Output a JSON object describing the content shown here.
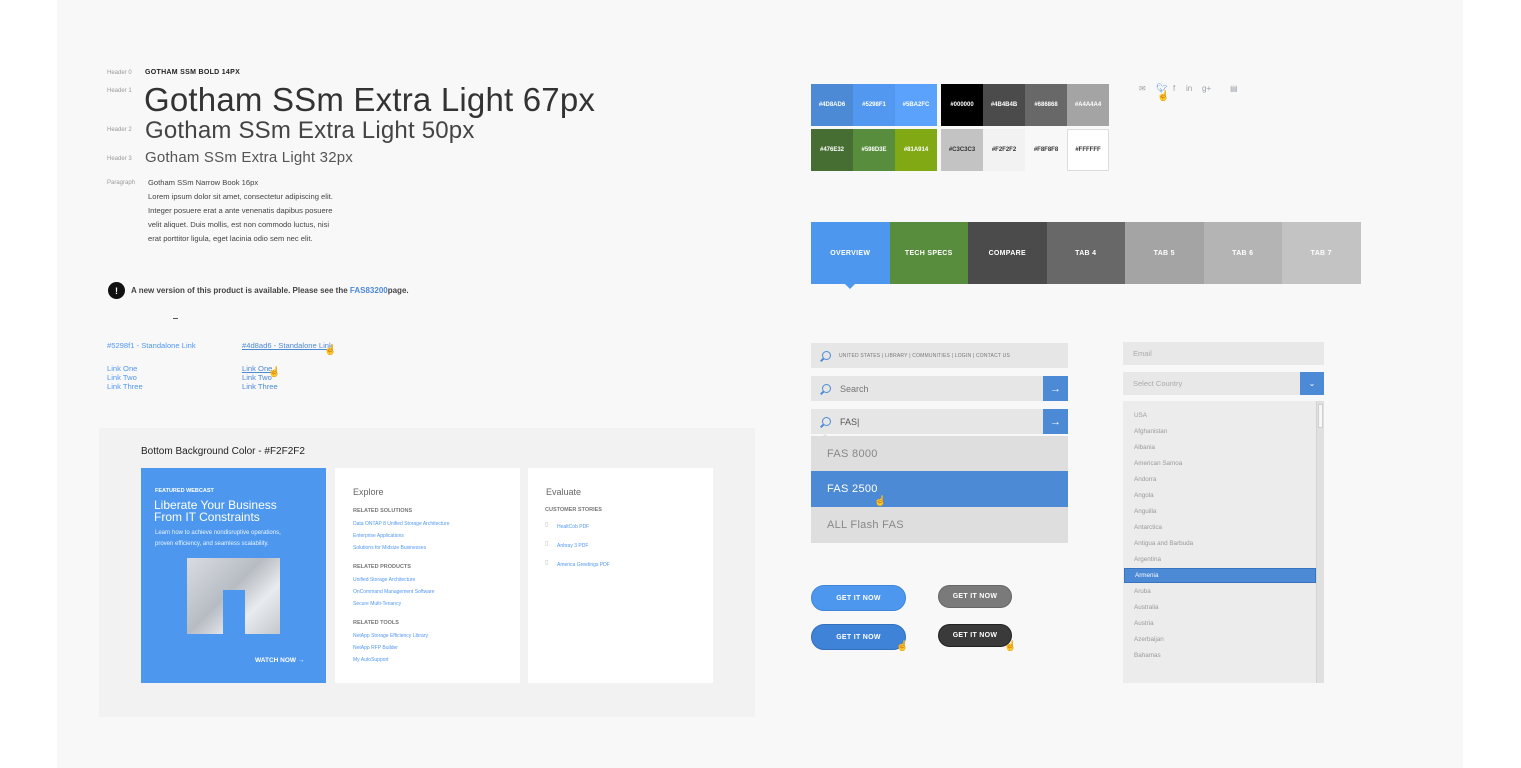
{
  "typography": {
    "header0_label": "Header 0",
    "header0_text": "GOTHAM SSM BOLD 14PX",
    "header1_label": "Header 1",
    "header1_text": "Gotham SSm Extra Light 67px",
    "header2_label": "Header 2",
    "header2_text": "Gotham SSm Extra Light 50px",
    "header3_label": "Header 3",
    "header3_text": "Gotham SSm Extra Light 32px",
    "paragraph_label": "Paragraph",
    "paragraph_lines": [
      "Gotham SSm Narrow Book 16px",
      "Lorem ipsum dolor sit amet, consectetur adipiscing elit.",
      "Integer posuere erat a ante venenatis dapibus posuere",
      "velit aliquet. Duis mollis, est non commodo luctus, nisi",
      "erat porttitor ligula, eget lacinia odio sem nec elit."
    ]
  },
  "alert": {
    "icon": "!",
    "text_before": "A new version of this product is available. Please see the ",
    "link": "FAS83200",
    "text_after": " page."
  },
  "links": {
    "col1_standalone": "#5298f1 - Standalone Link",
    "col2_standalone": "#4d8ad6 - Standalone Link",
    "col1_list": [
      "Link One",
      "Link Two",
      "Link Three"
    ],
    "col2_list": [
      "Link One",
      "Link Two",
      "Link Three"
    ]
  },
  "bottom_panel": {
    "title": "Bottom Background Color - #F2F2F2",
    "webcast": {
      "tag": "FEATURED WEBCAST",
      "title_line1": "Liberate Your Business",
      "title_line2": "From IT Constraints",
      "desc_line1": "Learn how to achieve nondisruptive operations,",
      "desc_line2": "proven efficiency, and seamless scalability.",
      "cta": "WATCH NOW →"
    },
    "explore": {
      "title": "Explore",
      "sections": [
        {
          "heading": "RELATED SOLUTIONS",
          "links": [
            "Data ONTAP 8 Unified Storage Architecture",
            "Enterprise Applications",
            "Solutions for Midsize Businesses"
          ]
        },
        {
          "heading": "RELATED PRODUCTS",
          "links": [
            "Unified Storage Architecture",
            "OnCommand Management Software",
            "Secure Multi-Tenancy"
          ]
        },
        {
          "heading": "RELATED TOOLS",
          "links": [
            "NetApp Storage Efficiency Library",
            "NetApp RFP Builder",
            "My AutoSupport"
          ]
        }
      ]
    },
    "evaluate": {
      "title": "Evaluate",
      "heading": "CUSTOMER STORIES",
      "items": [
        "HealtCob PDF",
        "Anbray 3 PDF",
        "America Greetings PDF"
      ]
    }
  },
  "swatches": {
    "blue": [
      "#4D8AD6",
      "#5298F1",
      "#5BA2FC"
    ],
    "green": [
      "#476E32",
      "#598D3E",
      "#81A914"
    ],
    "dark": [
      "#000000",
      "#4B4B4B",
      "#686868",
      "#A4A4A4"
    ],
    "light": [
      "#C3C3C3",
      "#F2F2F2",
      "#F8F8F8",
      "#FFFFFF"
    ]
  },
  "social_icons": [
    "mail-icon",
    "twitter-icon",
    "facebook-icon",
    "linkedin-icon",
    "googleplus-icon",
    "print-icon"
  ],
  "tabs": [
    {
      "label": "OVERVIEW",
      "color": "#4d98ee"
    },
    {
      "label": "TECH SPECS",
      "color": "#598d3e"
    },
    {
      "label": "COMPARE",
      "color": "#4b4b4b"
    },
    {
      "label": "TAB 4",
      "color": "#686868"
    },
    {
      "label": "TAB 5",
      "color": "#a4a4a4"
    },
    {
      "label": "TAB 6",
      "color": "#b4b4b4"
    },
    {
      "label": "TAB 7",
      "color": "#c3c3c3"
    }
  ],
  "utility_nav": "UNITED STATES  |  LIBRARY  |  COMMUNITIES  |  LOGIN  |  CONTACT US",
  "search": {
    "placeholder": "Search",
    "typed_value": "FAS|",
    "go_arrow": "→",
    "suggestions": [
      "FAS 8000",
      "FAS 2500",
      "ALL Flash FAS"
    ]
  },
  "buttons": {
    "cta1": "GET IT NOW",
    "cta2": "GET IT NOW",
    "cta3": "GET IT NOW",
    "cta4": "GET IT NOW"
  },
  "form": {
    "email_placeholder": "Email",
    "country_placeholder": "Select Country",
    "caret": "⌄",
    "countries": [
      "USA",
      "Afghanistan",
      "Albania",
      "American Samoa",
      "Andorra",
      "Angola",
      "Anguilla",
      "Antarctica",
      "Antigua and Barbuda",
      "Argentina",
      "Armenia",
      "Aruba",
      "Australia",
      "Austria",
      "Azerbaijan",
      "Bahamas"
    ],
    "selected_country": "Armenia"
  }
}
